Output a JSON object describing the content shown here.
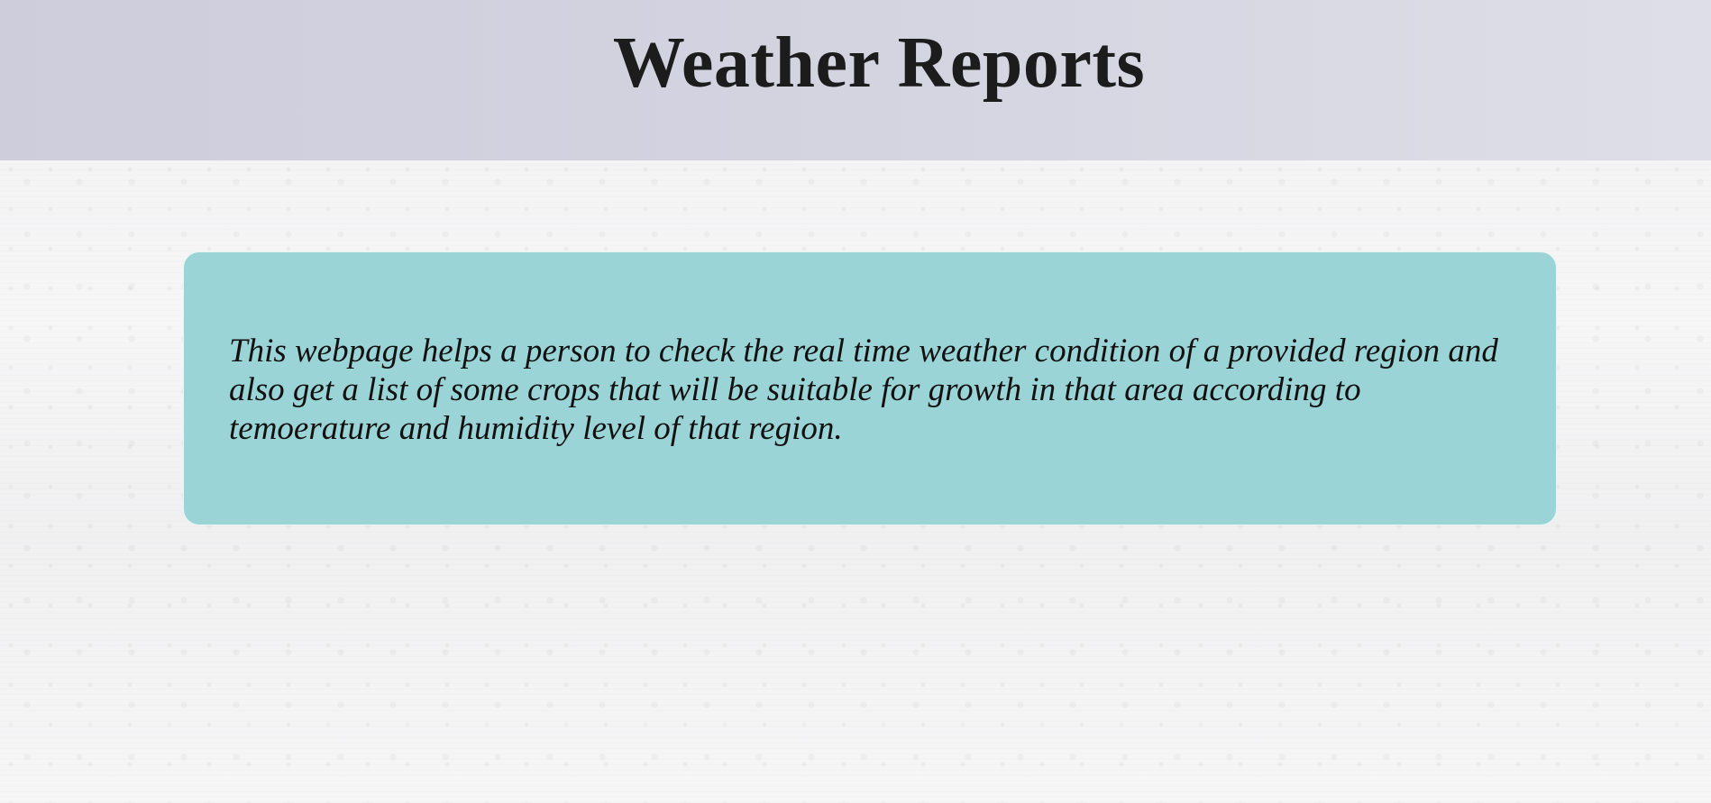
{
  "header": {
    "title": "Weather Reports"
  },
  "info": {
    "description": "This webpage helps a person to check the real time weather condition of a provided region and also get a list of some crops that will be suitable for growth in that area according to temoerature and humidity level of that region."
  },
  "colors": {
    "header_background": "#d3d3e0",
    "card_background": "#9bd4d6",
    "page_background": "#f3f3f4",
    "text": "#1c1c1c"
  }
}
